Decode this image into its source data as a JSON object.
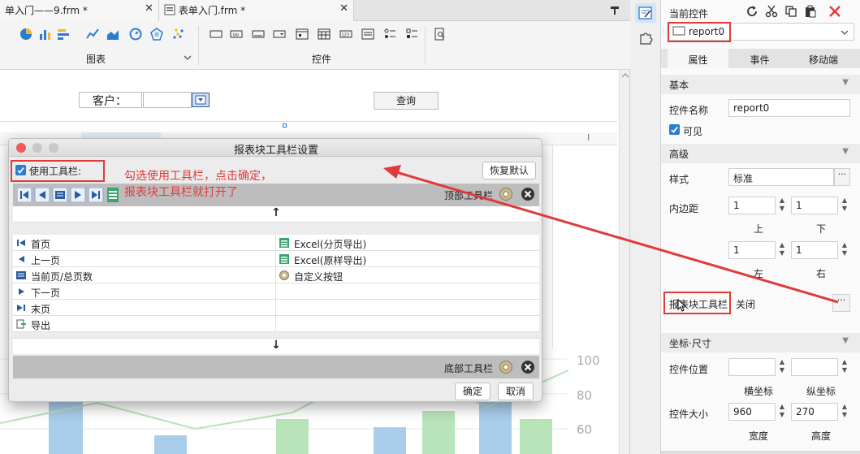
{
  "tabs": [
    {
      "label": "单入门——9.frm *"
    },
    {
      "label": "表单入门.frm *"
    }
  ],
  "ribbon": {
    "chart_group": "图表",
    "control_group": "控件"
  },
  "form": {
    "customer_label": "客户：",
    "query_button": "查询",
    "grid_col_i": "I"
  },
  "chart_axis": [
    "100",
    "80",
    "60"
  ],
  "dialog": {
    "title": "报表块工具栏设置",
    "use_toolbar_label": "使用工具栏:",
    "restore_default": "恢复默认",
    "top_toolbar": "顶部工具栏",
    "bottom_toolbar": "底部工具栏",
    "up_arrow": "↑",
    "down_arrow": "↓",
    "left_items": [
      "首页",
      "上一页",
      "当前页/总页数",
      "下一页",
      "末页",
      "导出"
    ],
    "right_items": [
      "Excel(分页导出)",
      "Excel(原样导出)",
      "自定义按钮"
    ],
    "ok": "确定",
    "cancel": "取消"
  },
  "annotation": {
    "line1": "勾选使用工具栏，点击确定，",
    "line2": "报表块工具栏就打开了"
  },
  "panel": {
    "title": "当前控件",
    "control_name_value": "report0",
    "tabs": [
      "属性",
      "事件",
      "移动端"
    ],
    "section_basic": "基本",
    "control_name_label": "控件名称",
    "control_name_input": "report0",
    "visible_label": "可见",
    "section_advanced": "高级",
    "style_label": "样式",
    "style_value": "标准",
    "padding_label": "内边距",
    "pad_top": "1",
    "pad_bottom": "1",
    "pad_left": "1",
    "pad_right": "1",
    "up": "上",
    "down": "下",
    "left": "左",
    "right": "右",
    "toolbar_label": "报表块工具栏",
    "toolbar_value": "关闭",
    "section_coord": "坐标·尺寸",
    "position_label": "控件位置",
    "x_label": "横坐标",
    "y_label": "纵坐标",
    "size_label": "控件大小",
    "width_value": "960",
    "height_value": "270",
    "width_label": "宽度",
    "height_label": "高度"
  },
  "colors": {
    "accent": "#2b7cd3",
    "annotation_red": "#e03a3a",
    "chart_blue": "#a9cdea",
    "chart_green": "#b9e3b9"
  }
}
